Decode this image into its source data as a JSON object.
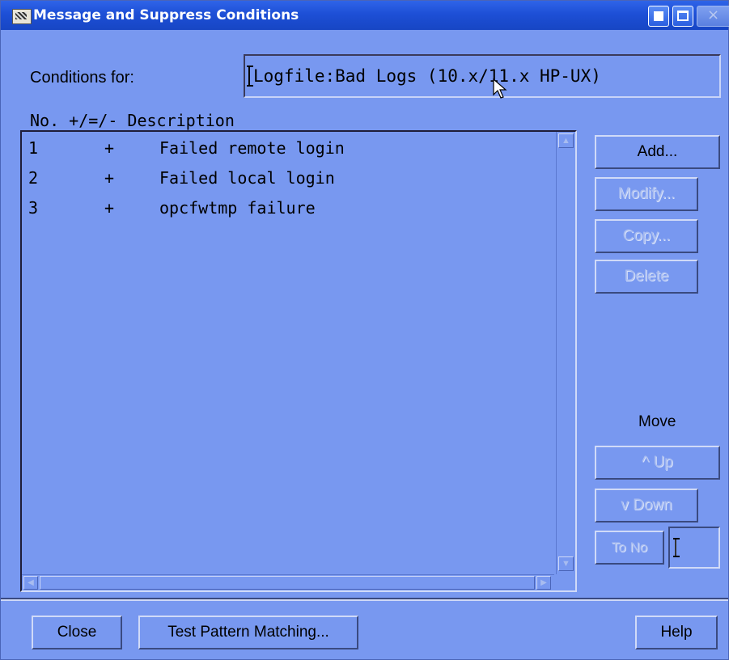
{
  "window": {
    "title": "Message and Suppress Conditions",
    "close_glyph": "×"
  },
  "conditions": {
    "label": "Conditions for:",
    "value": "Logfile:Bad Logs (10.x/11.x HP-UX)"
  },
  "list": {
    "header": "No. +/=/- Description",
    "rows": [
      {
        "no": "1",
        "sign": "+",
        "description": "Failed remote login"
      },
      {
        "no": "2",
        "sign": "+",
        "description": "Failed local login"
      },
      {
        "no": "3",
        "sign": "+",
        "description": "opcfwtmp failure"
      }
    ]
  },
  "actions": {
    "add": "Add...",
    "modify": "Modify...",
    "copy": "Copy...",
    "delete": "Delete",
    "move_label": "Move",
    "up": "^  Up",
    "down": "v Down",
    "to_no": "To No"
  },
  "footer": {
    "close": "Close",
    "test": "Test Pattern Matching...",
    "help": "Help"
  },
  "colors": {
    "background": "#7898f0",
    "titlebar": "#1d4fd6",
    "disabled_text": "#a8bcf0"
  }
}
